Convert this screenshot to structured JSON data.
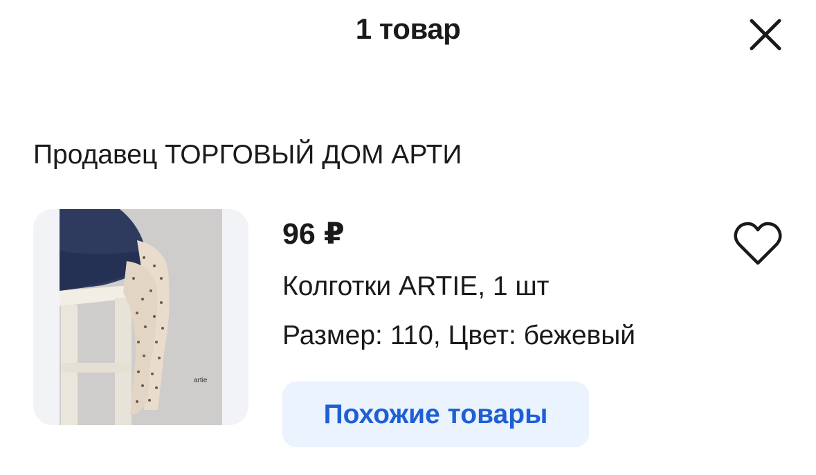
{
  "header": {
    "title": "1 товар",
    "close_icon": "close-icon"
  },
  "seller": {
    "label": "Продавец ТОРГОВЫЙ ДОМ АРТИ"
  },
  "product": {
    "price": "96 ₽",
    "name": "Колготки ARTIE, 1 шт",
    "attributes": "Размер: 110, Цвет: бежевый",
    "image_brand_text": "artie",
    "favorite_icon": "heart-icon",
    "similar_button_label": "Похожие товары"
  },
  "colors": {
    "accent_text": "#1f5fd6",
    "accent_bg": "#eaf3fe",
    "text": "#1a1a1a"
  }
}
